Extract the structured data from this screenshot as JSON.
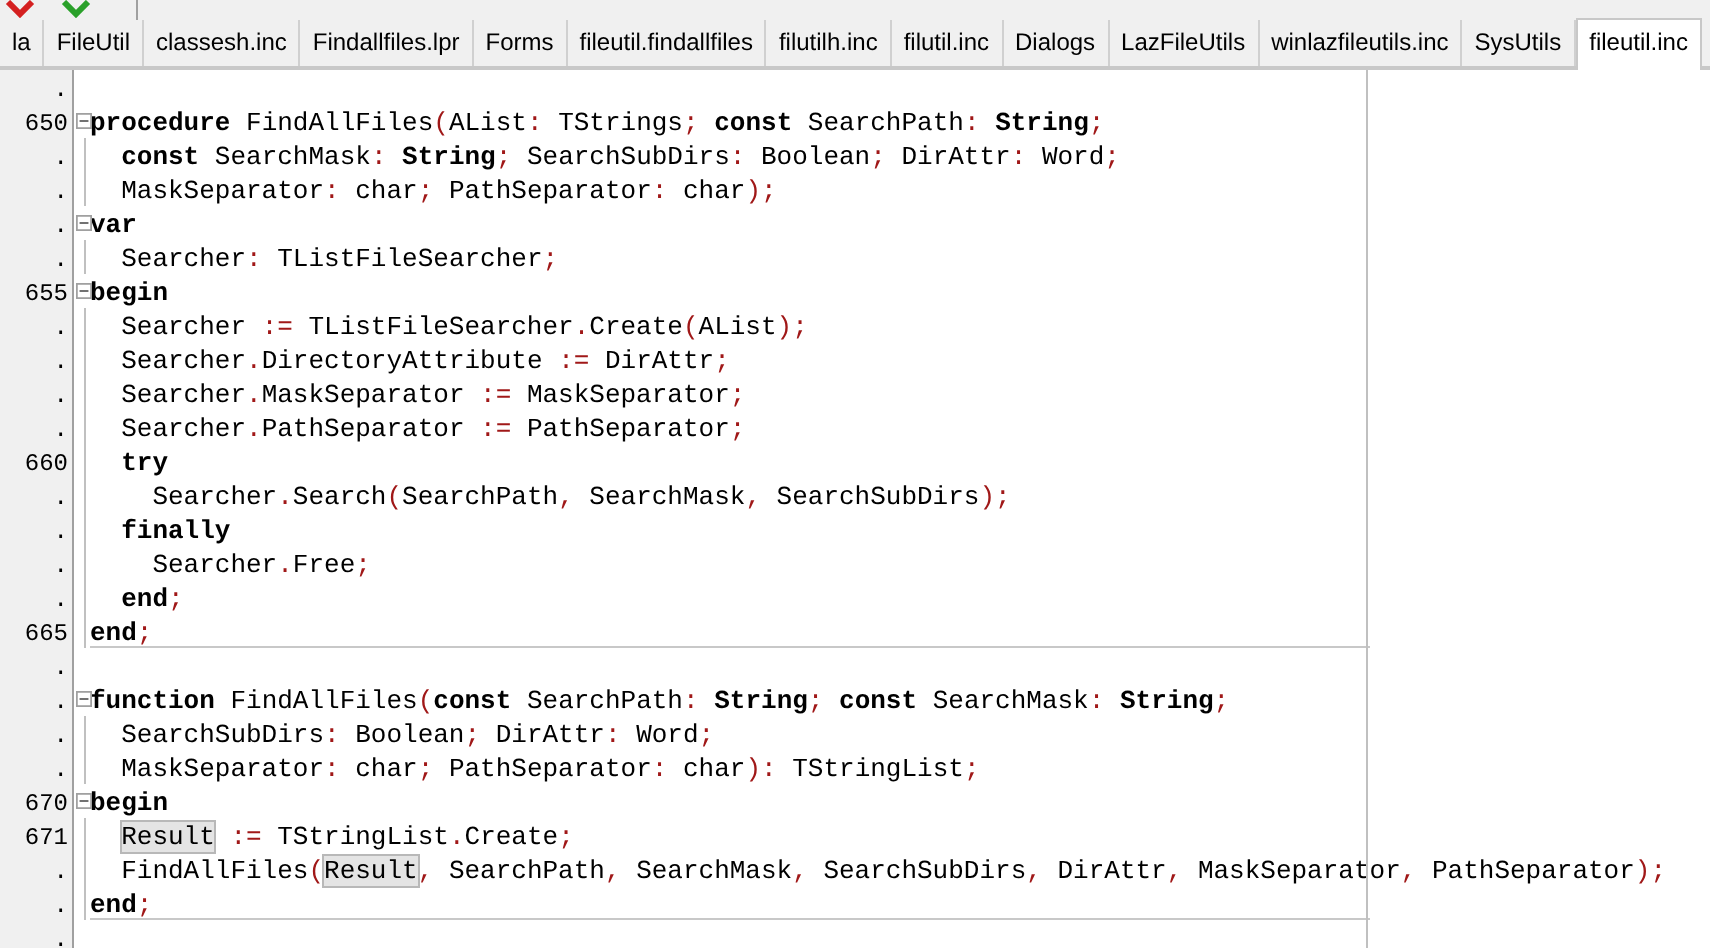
{
  "tabs": [
    {
      "label": "la",
      "selected": false
    },
    {
      "label": "FileUtil",
      "selected": false
    },
    {
      "label": "classesh.inc",
      "selected": false
    },
    {
      "label": "Findallfiles.lpr",
      "selected": false
    },
    {
      "label": "Forms",
      "selected": false
    },
    {
      "label": "fileutil.findallfiles",
      "selected": false
    },
    {
      "label": "filutilh.inc",
      "selected": false
    },
    {
      "label": "filutil.inc",
      "selected": false
    },
    {
      "label": "Dialogs",
      "selected": false
    },
    {
      "label": "LazFileUtils",
      "selected": false
    },
    {
      "label": "winlazfileutils.inc",
      "selected": false
    },
    {
      "label": "SysUtils",
      "selected": false
    },
    {
      "label": "fileutil.inc",
      "selected": true
    }
  ],
  "editor": {
    "lines": [
      {
        "number": ".",
        "fold_toggle": false,
        "fold_line": false,
        "separator_below": false
      },
      {
        "number": "650",
        "fold_toggle": true,
        "indented": false,
        "separator_below": false,
        "segments": [
          {
            "kind": "keyword",
            "text": "procedure"
          },
          {
            "kind": "plain",
            "text": " FindAllFiles"
          },
          {
            "kind": "symbol",
            "text": "("
          },
          {
            "kind": "plain",
            "text": "AList"
          },
          {
            "kind": "symbol",
            "text": ": "
          },
          {
            "kind": "plain",
            "text": "TStrings"
          },
          {
            "kind": "symbol",
            "text": "; "
          },
          {
            "kind": "keyword",
            "text": "const"
          },
          {
            "kind": "plain",
            "text": " SearchPath"
          },
          {
            "kind": "symbol",
            "text": ": "
          },
          {
            "kind": "keyword",
            "text": "String"
          },
          {
            "kind": "symbol",
            "text": ";"
          }
        ]
      },
      {
        "number": ".",
        "fold_toggle": false,
        "fold_line": true,
        "indented": true,
        "separator_below": false,
        "segments": [
          {
            "kind": "keyword",
            "text": "const"
          },
          {
            "kind": "plain",
            "text": " SearchMask"
          },
          {
            "kind": "symbol",
            "text": ": "
          },
          {
            "kind": "keyword",
            "text": "String"
          },
          {
            "kind": "symbol",
            "text": "; "
          },
          {
            "kind": "plain",
            "text": "SearchSubDirs"
          },
          {
            "kind": "symbol",
            "text": ": "
          },
          {
            "kind": "plain",
            "text": "Boolean"
          },
          {
            "kind": "symbol",
            "text": "; "
          },
          {
            "kind": "plain",
            "text": "DirAttr"
          },
          {
            "kind": "symbol",
            "text": ": "
          },
          {
            "kind": "plain",
            "text": "Word"
          },
          {
            "kind": "symbol",
            "text": ";"
          }
        ]
      },
      {
        "number": ".",
        "fold_toggle": false,
        "fold_line": true,
        "indented": true,
        "separator_below": false,
        "segments": [
          {
            "kind": "plain",
            "text": "MaskSeparator"
          },
          {
            "kind": "symbol",
            "text": ": "
          },
          {
            "kind": "plain",
            "text": "char"
          },
          {
            "kind": "symbol",
            "text": "; "
          },
          {
            "kind": "plain",
            "text": "PathSeparator"
          },
          {
            "kind": "symbol",
            "text": ": "
          },
          {
            "kind": "plain",
            "text": "char"
          },
          {
            "kind": "symbol",
            "text": ");"
          }
        ]
      },
      {
        "number": ".",
        "fold_toggle": true,
        "indented": false,
        "separator_below": false,
        "segments": [
          {
            "kind": "keyword",
            "text": "var"
          }
        ]
      },
      {
        "number": ".",
        "fold_toggle": false,
        "fold_line": true,
        "indented": true,
        "separator_below": false,
        "segments": [
          {
            "kind": "plain",
            "text": "Searcher"
          },
          {
            "kind": "symbol",
            "text": ": "
          },
          {
            "kind": "plain",
            "text": "TListFileSearcher"
          },
          {
            "kind": "symbol",
            "text": ";"
          }
        ]
      },
      {
        "number": "655",
        "fold_toggle": true,
        "indented": false,
        "separator_below": false,
        "segments": [
          {
            "kind": "keyword",
            "text": "begin"
          }
        ]
      },
      {
        "number": ".",
        "fold_toggle": false,
        "fold_line": true,
        "indented": true,
        "separator_below": false,
        "segments": [
          {
            "kind": "plain",
            "text": "Searcher "
          },
          {
            "kind": "symbol",
            "text": ":= "
          },
          {
            "kind": "plain",
            "text": "TListFileSearcher"
          },
          {
            "kind": "symbol",
            "text": "."
          },
          {
            "kind": "plain",
            "text": "Create"
          },
          {
            "kind": "symbol",
            "text": "("
          },
          {
            "kind": "plain",
            "text": "AList"
          },
          {
            "kind": "symbol",
            "text": ");"
          }
        ]
      },
      {
        "number": ".",
        "fold_toggle": false,
        "fold_line": true,
        "indented": true,
        "separator_below": false,
        "segments": [
          {
            "kind": "plain",
            "text": "Searcher"
          },
          {
            "kind": "symbol",
            "text": "."
          },
          {
            "kind": "plain",
            "text": "DirectoryAttribute "
          },
          {
            "kind": "symbol",
            "text": ":= "
          },
          {
            "kind": "plain",
            "text": "DirAttr"
          },
          {
            "kind": "symbol",
            "text": ";"
          }
        ]
      },
      {
        "number": ".",
        "fold_toggle": false,
        "fold_line": true,
        "indented": true,
        "separator_below": false,
        "segments": [
          {
            "kind": "plain",
            "text": "Searcher"
          },
          {
            "kind": "symbol",
            "text": "."
          },
          {
            "kind": "plain",
            "text": "MaskSeparator "
          },
          {
            "kind": "symbol",
            "text": ":= "
          },
          {
            "kind": "plain",
            "text": "MaskSeparator"
          },
          {
            "kind": "symbol",
            "text": ";"
          }
        ]
      },
      {
        "number": ".",
        "fold_toggle": false,
        "fold_line": true,
        "indented": true,
        "separator_below": false,
        "segments": [
          {
            "kind": "plain",
            "text": "Searcher"
          },
          {
            "kind": "symbol",
            "text": "."
          },
          {
            "kind": "plain",
            "text": "PathSeparator "
          },
          {
            "kind": "symbol",
            "text": ":= "
          },
          {
            "kind": "plain",
            "text": "PathSeparator"
          },
          {
            "kind": "symbol",
            "text": ";"
          }
        ]
      },
      {
        "number": "660",
        "fold_toggle": false,
        "fold_line": true,
        "indented": true,
        "separator_below": false,
        "segments": [
          {
            "kind": "keyword",
            "text": "try"
          }
        ]
      },
      {
        "number": ".",
        "fold_toggle": false,
        "fold_line": true,
        "indented": true,
        "separator_below": false,
        "segments": [
          {
            "kind": "plain",
            "text": "  Searcher"
          },
          {
            "kind": "symbol",
            "text": "."
          },
          {
            "kind": "plain",
            "text": "Search"
          },
          {
            "kind": "symbol",
            "text": "("
          },
          {
            "kind": "plain",
            "text": "SearchPath"
          },
          {
            "kind": "symbol",
            "text": ", "
          },
          {
            "kind": "plain",
            "text": "SearchMask"
          },
          {
            "kind": "symbol",
            "text": ", "
          },
          {
            "kind": "plain",
            "text": "SearchSubDirs"
          },
          {
            "kind": "symbol",
            "text": ");"
          }
        ]
      },
      {
        "number": ".",
        "fold_toggle": false,
        "fold_line": true,
        "indented": true,
        "separator_below": false,
        "segments": [
          {
            "kind": "keyword",
            "text": "finally"
          }
        ]
      },
      {
        "number": ".",
        "fold_toggle": false,
        "fold_line": true,
        "indented": true,
        "separator_below": false,
        "segments": [
          {
            "kind": "plain",
            "text": "  Searcher"
          },
          {
            "kind": "symbol",
            "text": "."
          },
          {
            "kind": "plain",
            "text": "Free"
          },
          {
            "kind": "symbol",
            "text": ";"
          }
        ]
      },
      {
        "number": ".",
        "fold_toggle": false,
        "fold_line": true,
        "indented": true,
        "separator_below": false,
        "segments": [
          {
            "kind": "keyword",
            "text": "end"
          },
          {
            "kind": "symbol",
            "text": ";"
          }
        ]
      },
      {
        "number": "665",
        "fold_toggle": false,
        "fold_line": true,
        "indented": false,
        "separator_below": true,
        "segments": [
          {
            "kind": "keyword",
            "text": "end"
          },
          {
            "kind": "symbol",
            "text": ";"
          }
        ]
      },
      {
        "number": ".",
        "fold_toggle": false,
        "fold_line": false,
        "separator_below": false
      },
      {
        "number": ".",
        "fold_toggle": true,
        "indented": false,
        "separator_below": false,
        "segments": [
          {
            "kind": "keyword",
            "text": "function"
          },
          {
            "kind": "plain",
            "text": " FindAllFiles"
          },
          {
            "kind": "symbol",
            "text": "("
          },
          {
            "kind": "keyword",
            "text": "const"
          },
          {
            "kind": "plain",
            "text": " SearchPath"
          },
          {
            "kind": "symbol",
            "text": ": "
          },
          {
            "kind": "keyword",
            "text": "String"
          },
          {
            "kind": "symbol",
            "text": "; "
          },
          {
            "kind": "keyword",
            "text": "const"
          },
          {
            "kind": "plain",
            "text": " SearchMask"
          },
          {
            "kind": "symbol",
            "text": ": "
          },
          {
            "kind": "keyword",
            "text": "String"
          },
          {
            "kind": "symbol",
            "text": ";"
          }
        ]
      },
      {
        "number": ".",
        "fold_toggle": false,
        "fold_line": true,
        "indented": true,
        "separator_below": false,
        "segments": [
          {
            "kind": "plain",
            "text": "SearchSubDirs"
          },
          {
            "kind": "symbol",
            "text": ": "
          },
          {
            "kind": "plain",
            "text": "Boolean"
          },
          {
            "kind": "symbol",
            "text": "; "
          },
          {
            "kind": "plain",
            "text": "DirAttr"
          },
          {
            "kind": "symbol",
            "text": ": "
          },
          {
            "kind": "plain",
            "text": "Word"
          },
          {
            "kind": "symbol",
            "text": ";"
          }
        ]
      },
      {
        "number": ".",
        "fold_toggle": false,
        "fold_line": true,
        "indented": true,
        "separator_below": false,
        "segments": [
          {
            "kind": "plain",
            "text": "MaskSeparator"
          },
          {
            "kind": "symbol",
            "text": ": "
          },
          {
            "kind": "plain",
            "text": "char"
          },
          {
            "kind": "symbol",
            "text": "; "
          },
          {
            "kind": "plain",
            "text": "PathSeparator"
          },
          {
            "kind": "symbol",
            "text": ": "
          },
          {
            "kind": "plain",
            "text": "char"
          },
          {
            "kind": "symbol",
            "text": "): "
          },
          {
            "kind": "plain",
            "text": "TStringList"
          },
          {
            "kind": "symbol",
            "text": ";"
          }
        ]
      },
      {
        "number": "670",
        "fold_toggle": true,
        "indented": false,
        "separator_below": false,
        "segments": [
          {
            "kind": "keyword",
            "text": "begin"
          }
        ]
      },
      {
        "number": "671",
        "fold_toggle": false,
        "fold_line": true,
        "indented": true,
        "separator_below": false,
        "segments": [
          {
            "kind": "match",
            "text": "Result"
          },
          {
            "kind": "symbol",
            "text": " := "
          },
          {
            "kind": "plain",
            "text": "TStringList"
          },
          {
            "kind": "symbol",
            "text": "."
          },
          {
            "kind": "plain",
            "text": "Create"
          },
          {
            "kind": "symbol",
            "text": ";"
          }
        ]
      },
      {
        "number": ".",
        "fold_toggle": false,
        "fold_line": true,
        "indented": true,
        "separator_below": false,
        "segments": [
          {
            "kind": "plain",
            "text": "FindAllFiles"
          },
          {
            "kind": "symbol",
            "text": "("
          },
          {
            "kind": "match",
            "text": "Result"
          },
          {
            "kind": "symbol",
            "text": ", "
          },
          {
            "kind": "plain",
            "text": "SearchPath"
          },
          {
            "kind": "symbol",
            "text": ", "
          },
          {
            "kind": "plain",
            "text": "SearchMask"
          },
          {
            "kind": "symbol",
            "text": ", "
          },
          {
            "kind": "plain",
            "text": "SearchSubDirs"
          },
          {
            "kind": "symbol",
            "text": ", "
          },
          {
            "kind": "plain",
            "text": "DirAttr"
          },
          {
            "kind": "symbol",
            "text": ", "
          },
          {
            "kind": "plain",
            "text": "MaskSeparator"
          },
          {
            "kind": "symbol",
            "text": ", "
          },
          {
            "kind": "plain",
            "text": "PathSeparator"
          },
          {
            "kind": "symbol",
            "text": ");"
          }
        ]
      },
      {
        "number": ".",
        "fold_toggle": false,
        "fold_line": true,
        "indented": false,
        "separator_below": true,
        "segments": [
          {
            "kind": "keyword",
            "text": "end"
          },
          {
            "kind": "symbol",
            "text": ";"
          }
        ]
      },
      {
        "number": ".",
        "fold_toggle": false,
        "fold_line": false
      }
    ]
  }
}
